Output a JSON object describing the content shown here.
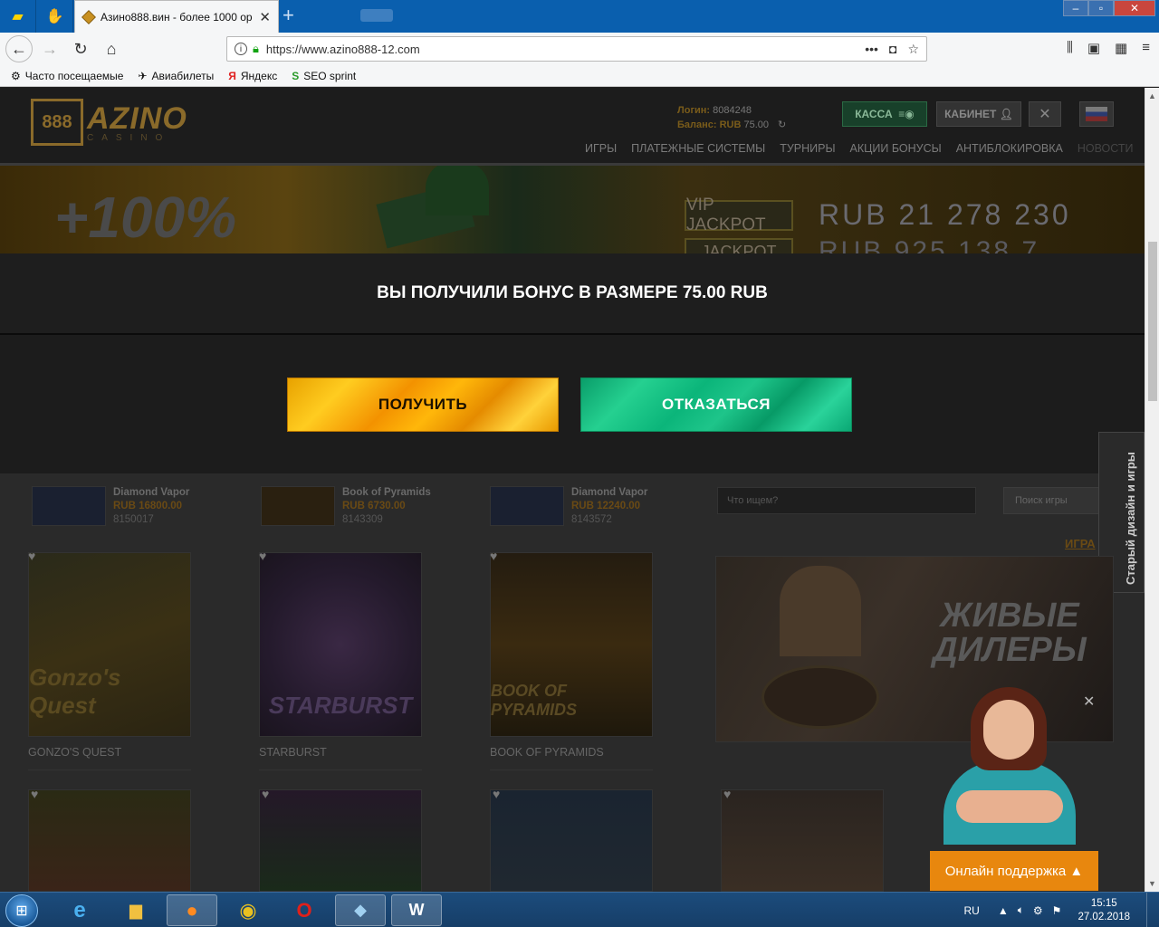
{
  "browser": {
    "tab_title": "Азино888.вин - более 1000 ор",
    "new_tab": "+",
    "url": "https://www.azino888-12.com",
    "bookmarks": [
      {
        "label": "Часто посещаемые",
        "icon": "gear-icon"
      },
      {
        "label": "Авиабилеты",
        "icon": "plane-icon"
      },
      {
        "label": "Яндекс",
        "icon": "yandex-icon"
      },
      {
        "label": "SEO sprint",
        "icon": "seo-sprint-icon"
      }
    ]
  },
  "site": {
    "logo_main": "AZINO",
    "logo_sub": "CASINO",
    "logo_mark": "888",
    "account": {
      "login_label": "Логин:",
      "login_value": "8084248",
      "balance_label": "Баланс: RUB",
      "balance_value": "75.00"
    },
    "kassa_label": "КАССА",
    "kabinet_label": "КАБИНЕТ",
    "menu": [
      "ИГРЫ",
      "ПЛАТЕЖНЫЕ СИСТЕМЫ",
      "ТУРНИРЫ",
      "АКЦИИ БОНУСЫ",
      "АНТИБЛОКИРОВКА",
      "НОВОСТИ"
    ],
    "banner": {
      "bonus": "+100%",
      "vip_label": "VIP JACKPOT",
      "vip_value": "RUB 21 278 230",
      "jackpot_label": "JACKPOT",
      "jackpot_value": "RUB 925 138 7"
    }
  },
  "modal": {
    "message": "ВЫ ПОЛУЧИЛИ БОНУС В РАЗМЕРЕ 75.00 RUB",
    "accept_label": "ПОЛУЧИТЬ",
    "decline_label": "ОТКАЗАТЬСЯ"
  },
  "winners": [
    {
      "game": "Diamond Vapor",
      "amount": "RUB 16800.00",
      "id": "8150017"
    },
    {
      "game": "Book of Pyramids",
      "amount": "RUB 6730.00",
      "id": "8143309"
    },
    {
      "game": "Diamond Vapor",
      "amount": "RUB 12240.00",
      "id": "8143572"
    }
  ],
  "search": {
    "placeholder": "Что ищем?",
    "button": "Поиск игры"
  },
  "all_games_link": "ИГРА",
  "side_tab": "Старый дизайн и игры",
  "games": [
    {
      "name": "GONZO'S QUEST",
      "art": "Gonzo's Quest"
    },
    {
      "name": "STARBURST",
      "art": "STARBURST"
    },
    {
      "name": "BOOK OF PYRAMIDS",
      "art": "BOOK OF PYRAMIDS"
    }
  ],
  "live_dealers": "ЖИВЫЕ ДИЛЕРЫ",
  "support": {
    "label": "Онлайн поддержка ▲"
  },
  "taskbar": {
    "language": "RU",
    "time": "15:15",
    "date": "27.02.2018"
  }
}
